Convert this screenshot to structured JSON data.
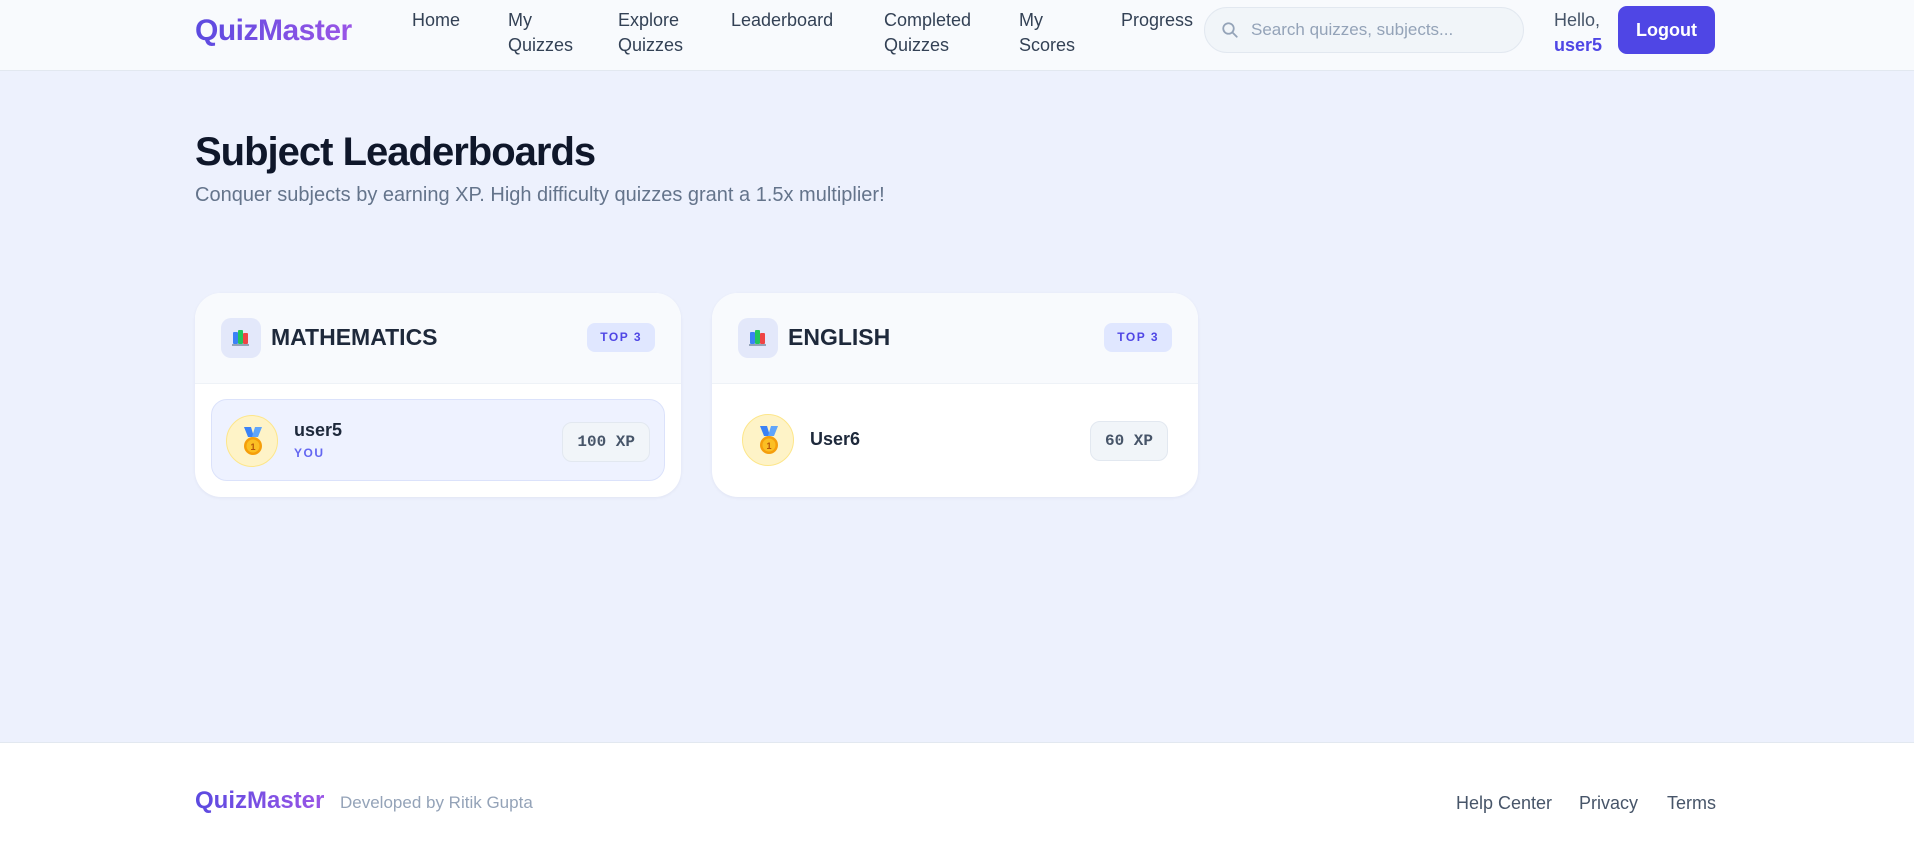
{
  "header": {
    "logo": "QuizMaster",
    "nav": {
      "home": "Home",
      "my_quizzes_1": "My",
      "my_quizzes_2": "Quizzes",
      "explore_1": "Explore",
      "explore_2": "Quizzes",
      "leaderboard": "Leaderboard",
      "completed_1": "Completed",
      "completed_2": "Quizzes",
      "scores_1": "My",
      "scores_2": "Scores",
      "progress": "Progress"
    },
    "search": {
      "placeholder": "Search quizzes, subjects...",
      "icon": "search-icon"
    },
    "greeting": "Hello,",
    "username": "user5",
    "logout_label": "Logout",
    "accent_color": "#4f46e5"
  },
  "main": {
    "title": "Subject Leaderboards",
    "subtitle": "Conquer subjects by earning XP. High difficulty quizzes grant a 1.5x multiplier!",
    "boards": [
      {
        "subject": "MATHEMATICS",
        "badge": "TOP 3",
        "icon": "books-icon",
        "entries": [
          {
            "rank_icon": "gold-medal-icon",
            "name": "user5",
            "tag": "YOU",
            "xp": "100 XP"
          }
        ]
      },
      {
        "subject": "ENGLISH",
        "badge": "TOP 3",
        "icon": "books-icon",
        "entries": [
          {
            "rank_icon": "gold-medal-icon",
            "name": "User6",
            "xp": "60 XP"
          }
        ]
      }
    ]
  },
  "footer": {
    "logo": "QuizMaster",
    "credit": "Developed by Ritik Gupta",
    "links": {
      "help": "Help Center",
      "privacy": "Privacy",
      "terms": "Terms"
    }
  }
}
